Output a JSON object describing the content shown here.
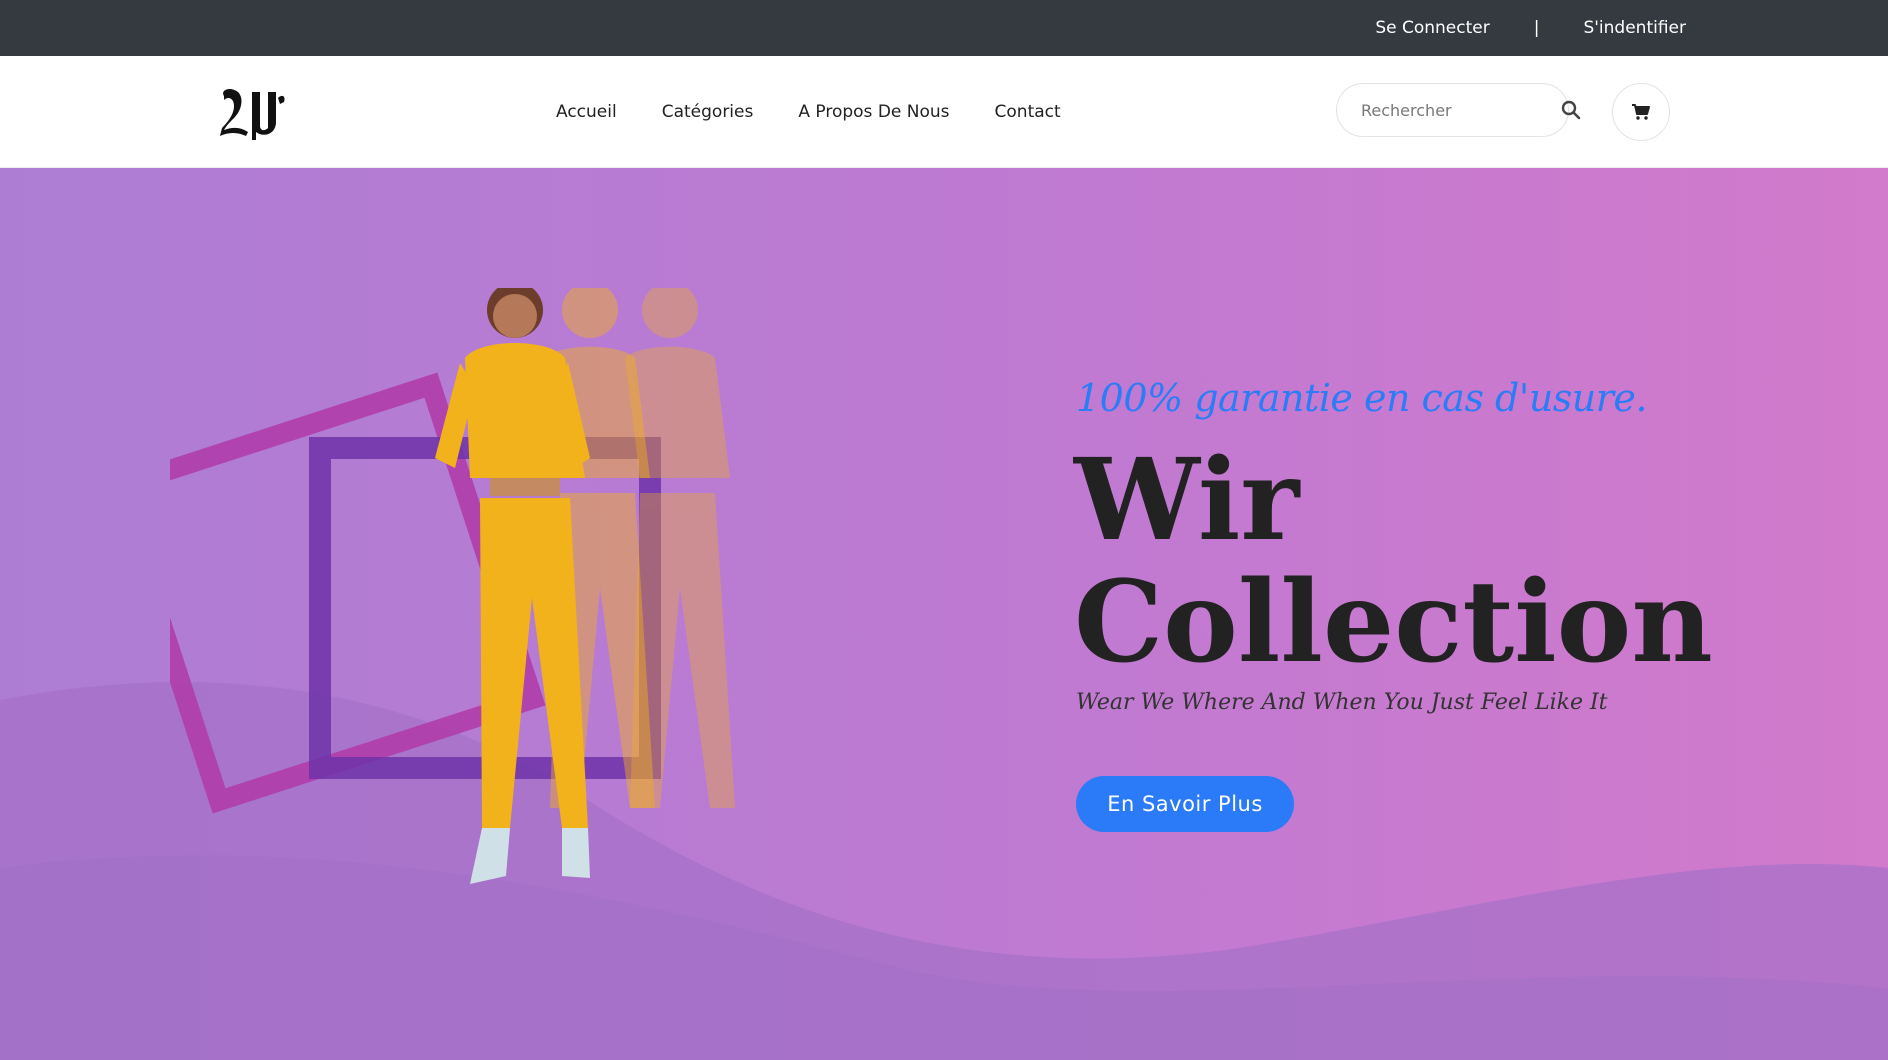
{
  "topbar": {
    "login_label": "Se Connecter",
    "separator": "|",
    "register_label": "S'indentifier"
  },
  "nav": {
    "logo_icon": "wir-monogram-logo",
    "items": [
      {
        "label": "Accueil"
      },
      {
        "label": "Catégories"
      },
      {
        "label": "A Propos De Nous"
      },
      {
        "label": "Contact"
      }
    ],
    "search": {
      "placeholder": "Rechercher",
      "icon": "search-icon"
    },
    "cart": {
      "icon": "cart-icon"
    }
  },
  "hero": {
    "tagline": "100% garantie en cas d'usure.",
    "title_line1": "Wir",
    "title_line2": "Collection",
    "subtitle": "Wear We Where And When You Just Feel Like It",
    "cta_label": "En Savoir Plus"
  },
  "colors": {
    "topbar_bg": "#343a40",
    "hero_gradient_start": "#ad7dd4",
    "hero_gradient_end": "#d27acb",
    "accent": "#2b7af7",
    "outfit": "#f2b21c"
  }
}
